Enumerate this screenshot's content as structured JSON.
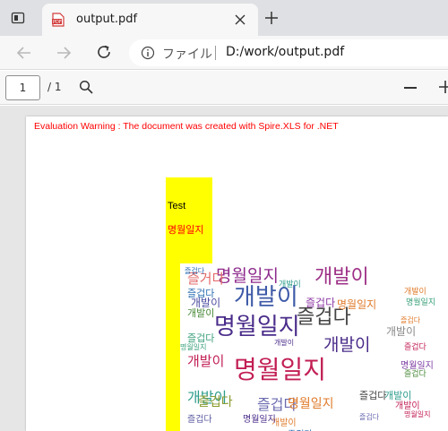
{
  "browser": {
    "tab_title": "output.pdf",
    "address": {
      "site_label": "ファイル",
      "url": "D:/work/output.pdf"
    }
  },
  "pdf_toolbar": {
    "page_current": "1",
    "page_total": "/ 1"
  },
  "document": {
    "warning": "Evaluation Warning : The document was created with  Spire.XLS for .NET",
    "cells": {
      "a1": "Test",
      "a2": "명월일지"
    },
    "word_cloud": {
      "words": [
        {
          "text": "명월일지",
          "size": 19,
          "color": "#8e2a8c"
        },
        {
          "text": "개발이",
          "size": 22,
          "color": "#9d2f86"
        },
        {
          "text": "개발이",
          "size": 26,
          "color": "#3e5aa8"
        },
        {
          "text": "즐거다",
          "size": 15,
          "color": "#e36b6b"
        },
        {
          "text": "명월일지",
          "size": 26,
          "color": "#4a2c8a"
        },
        {
          "text": "즐겁다",
          "size": 22,
          "color": "#444444"
        },
        {
          "text": "개발이",
          "size": 19,
          "color": "#4a2c8a"
        },
        {
          "text": "개발이",
          "size": 15,
          "color": "#c21f54"
        },
        {
          "text": "명월일지",
          "size": 28,
          "color": "#c21f54"
        },
        {
          "text": "개발이",
          "size": 16,
          "color": "#2e9c8d"
        },
        {
          "text": "즐겁다",
          "size": 14,
          "color": "#8a9b2e"
        },
        {
          "text": "즐겁다",
          "size": 16,
          "color": "#6a6ab0"
        },
        {
          "text": "명월일지",
          "size": 14,
          "color": "#e07b2b"
        },
        {
          "text": "즐겁다",
          "size": 11,
          "color": "#2d6fb3"
        },
        {
          "text": "개발이",
          "size": 12,
          "color": "#4a4aa0"
        },
        {
          "text": "즐겁다",
          "size": 12,
          "color": "#8d3aa6"
        },
        {
          "text": "개발이",
          "size": 11,
          "color": "#4a8a3a"
        },
        {
          "text": "즐겁다",
          "size": 11,
          "color": "#3aa07a"
        },
        {
          "text": "개발이",
          "size": 12,
          "color": "#888888"
        },
        {
          "text": "명월일지",
          "size": 12,
          "color": "#e07b2b"
        },
        {
          "text": "개발이",
          "size": 11,
          "color": "#2e9c8d"
        },
        {
          "text": "즐겁다",
          "size": 11,
          "color": "#444444"
        },
        {
          "text": "즐겁다",
          "size": 10,
          "color": "#2d6fb3"
        },
        {
          "text": "개발이",
          "size": 10,
          "color": "#e07b2b"
        },
        {
          "text": "명월일지",
          "size": 10,
          "color": "#7a3aa0"
        },
        {
          "text": "즐겁다",
          "size": 10,
          "color": "#5a5aa0"
        },
        {
          "text": "개발이",
          "size": 10,
          "color": "#c21f54"
        },
        {
          "text": "명월일지",
          "size": 10,
          "color": "#4a2c8a"
        },
        {
          "text": "즐겁다",
          "size": 9,
          "color": "#4a8a3a"
        },
        {
          "text": "개발이",
          "size": 9,
          "color": "#e07b2b"
        },
        {
          "text": "명월일지",
          "size": 9,
          "color": "#3aa07a"
        },
        {
          "text": "즐겁다",
          "size": 9,
          "color": "#c21f54"
        },
        {
          "text": "개발이",
          "size": 9,
          "color": "#2e9c8d"
        },
        {
          "text": "즐겁다",
          "size": 8,
          "color": "#2d6fb3"
        },
        {
          "text": "개발이",
          "size": 8,
          "color": "#8a9b2e"
        },
        {
          "text": "명월일지",
          "size": 8,
          "color": "#c21f54"
        },
        {
          "text": "즐겁다",
          "size": 8,
          "color": "#e07b2b"
        },
        {
          "text": "개발이",
          "size": 8,
          "color": "#4a2c8a"
        },
        {
          "text": "명월일지",
          "size": 8,
          "color": "#3aa07a"
        },
        {
          "text": "즐겁다",
          "size": 8,
          "color": "#6a6ab0"
        }
      ]
    }
  },
  "colors": {
    "warning": "#ff0000",
    "cell_highlight": "#ffff00",
    "tab_strip": "#dfe0e3",
    "toolbar": "#f7f7f7"
  }
}
